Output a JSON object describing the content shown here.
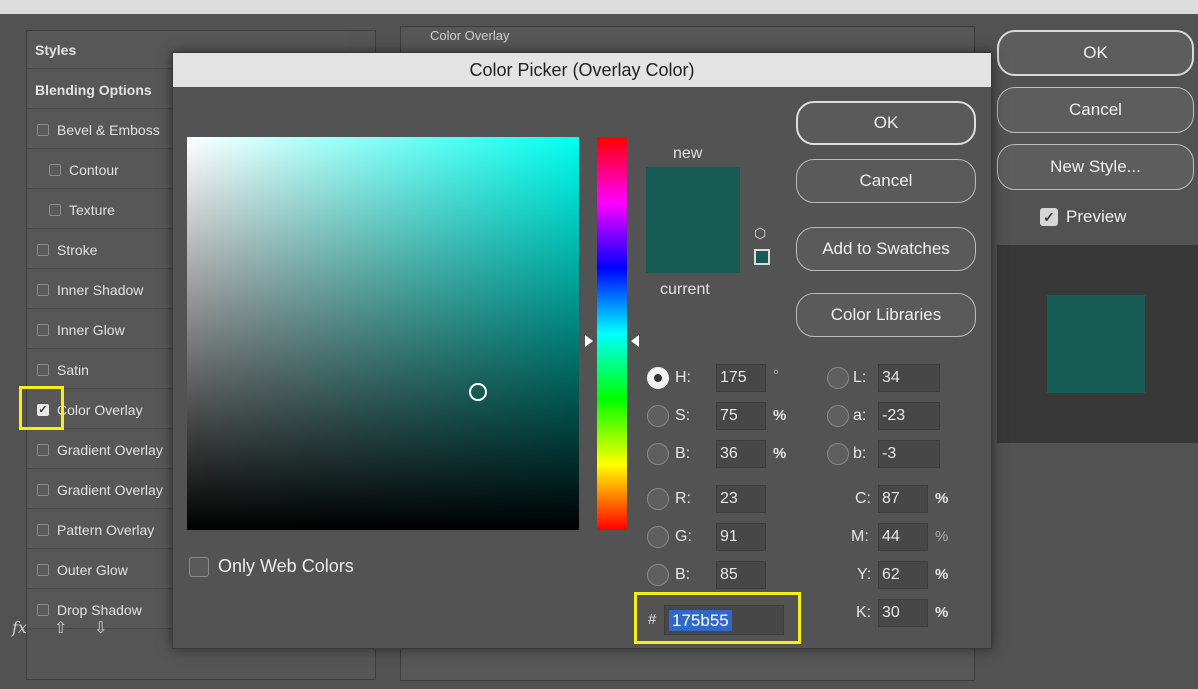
{
  "layer_style": {
    "section_title": "Color Overlay",
    "styles_header": "Styles",
    "blending_options": "Blending Options",
    "style_items": [
      {
        "label": "Bevel & Emboss",
        "checked": false
      },
      {
        "label": "Contour",
        "checked": false
      },
      {
        "label": "Texture",
        "checked": false
      },
      {
        "label": "Stroke",
        "checked": false
      },
      {
        "label": "Inner Shadow",
        "checked": false
      },
      {
        "label": "Inner Glow",
        "checked": false
      },
      {
        "label": "Satin",
        "checked": false
      },
      {
        "label": "Color Overlay",
        "checked": true
      },
      {
        "label": "Gradient Overlay",
        "checked": false
      },
      {
        "label": "Gradient Overlay",
        "checked": false
      },
      {
        "label": "Pattern Overlay",
        "checked": false
      },
      {
        "label": "Outer Glow",
        "checked": false
      },
      {
        "label": "Drop Shadow",
        "checked": false
      }
    ],
    "fx_label": "fx",
    "buttons": {
      "ok": "OK",
      "cancel": "Cancel",
      "new_style": "New Style..."
    },
    "preview_label": "Preview",
    "preview_checked": true
  },
  "color_picker": {
    "title": "Color Picker (Overlay Color)",
    "new_label": "new",
    "current_label": "current",
    "new_color": "#175b55",
    "current_color": "#175b55",
    "buttons": {
      "ok": "OK",
      "cancel": "Cancel",
      "add_to_swatches": "Add to Swatches",
      "color_libraries": "Color Libraries"
    },
    "only_web_colors": "Only Web Colors",
    "hsb": {
      "h_label": "H:",
      "h": "175",
      "h_unit": "°",
      "s_label": "S:",
      "s": "75",
      "s_unit": "%",
      "b_label": "B:",
      "b": "36",
      "b_unit": "%"
    },
    "rgb": {
      "r_label": "R:",
      "r": "23",
      "g_label": "G:",
      "g": "91",
      "b_label": "B:",
      "b": "85"
    },
    "lab": {
      "l_label": "L:",
      "l": "34",
      "a_label": "a:",
      "a": "-23",
      "b_label": "b:",
      "b": "-3"
    },
    "cmyk": {
      "c_label": "C:",
      "c": "87",
      "m_label": "M:",
      "m": "44",
      "y_label": "Y:",
      "y": "62",
      "k_label": "K:",
      "k": "30",
      "unit": "%"
    },
    "hex_hash": "#",
    "hex": "175b55",
    "selected_mode": "H",
    "hue_base_color": "#00fff0",
    "highlight_color": "#f6ee15"
  }
}
